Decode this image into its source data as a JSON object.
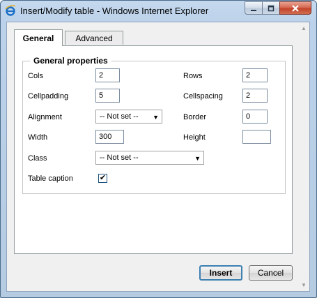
{
  "window": {
    "title": "Insert/Modify table - Windows Internet Explorer",
    "close_glyph": "✕",
    "minimize_glyph": "▁",
    "maximize_glyph": "▭"
  },
  "tabs": {
    "general": "General",
    "advanced": "Advanced"
  },
  "general_properties": {
    "legend": "General properties",
    "cols_label": "Cols",
    "cols_value": "2",
    "rows_label": "Rows",
    "rows_value": "2",
    "cellpadding_label": "Cellpadding",
    "cellpadding_value": "5",
    "cellspacing_label": "Cellspacing",
    "cellspacing_value": "2",
    "alignment_label": "Alignment",
    "alignment_value": "-- Not set --",
    "border_label": "Border",
    "border_value": "0",
    "width_label": "Width",
    "width_value": "300",
    "height_label": "Height",
    "height_value": "",
    "class_label": "Class",
    "class_value": "-- Not set --",
    "caption_label": "Table caption",
    "caption_checked": true,
    "check_glyph": "✔",
    "arrow_glyph": "▼"
  },
  "buttons": {
    "insert": "Insert",
    "cancel": "Cancel"
  },
  "icons": {
    "app": "ie-icon",
    "scroll_up": "▲",
    "scroll_down": "▼",
    "grip": "⋰"
  }
}
